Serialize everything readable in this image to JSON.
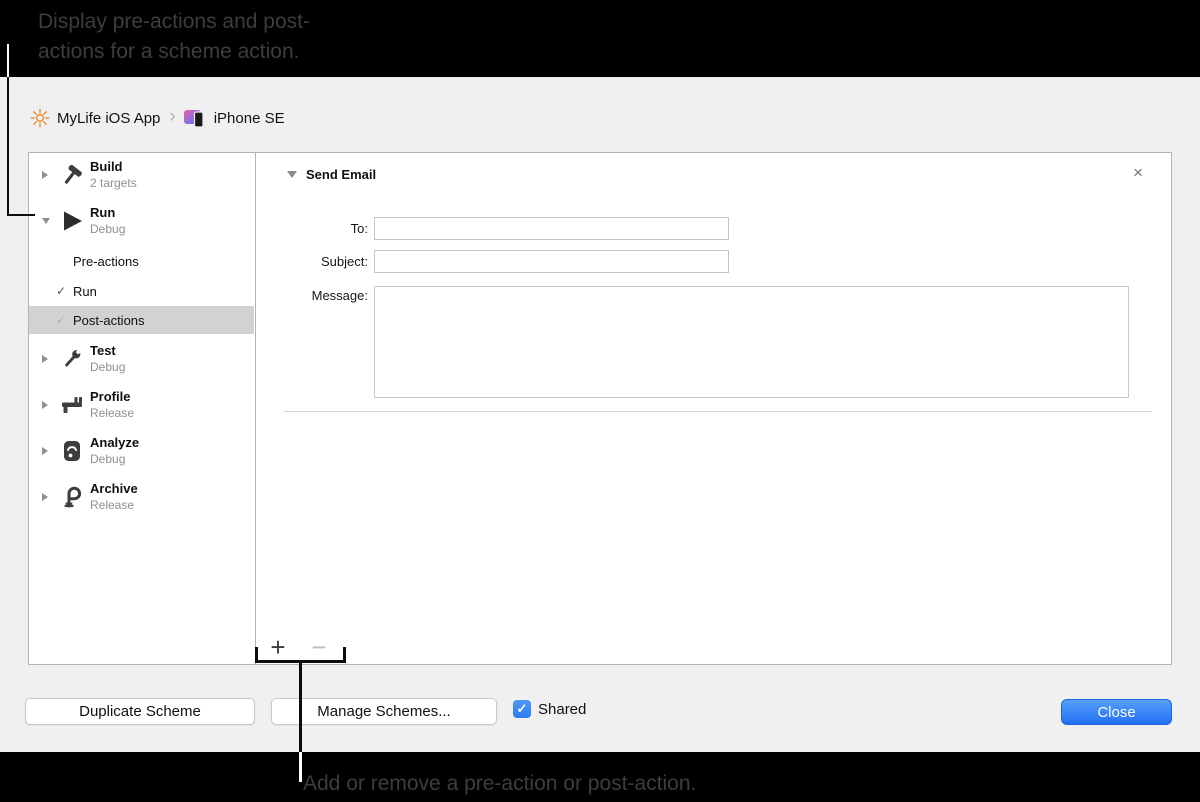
{
  "callouts": {
    "top_line1": "Display pre-actions and post-",
    "top_line2": "actions for a scheme action.",
    "bottom": "Add or remove a pre-action or post-action."
  },
  "glyphs": {
    "check": "✓",
    "close": "×",
    "plus": "+",
    "minus": "−"
  },
  "breadcrumb": {
    "scheme_name": "MyLife iOS App",
    "separator": "›",
    "destination_name": "iPhone SE"
  },
  "sidebar": {
    "build": {
      "label": "Build",
      "sublabel": "2 targets"
    },
    "run": {
      "label": "Run",
      "sublabel": "Debug"
    },
    "run_children": {
      "pre": "Pre-actions",
      "run": "Run",
      "post": "Post-actions"
    },
    "test": {
      "label": "Test",
      "sublabel": "Debug"
    },
    "profile": {
      "label": "Profile",
      "sublabel": "Release"
    },
    "analyze": {
      "label": "Analyze",
      "sublabel": "Debug"
    },
    "archive": {
      "label": "Archive",
      "sublabel": "Release"
    }
  },
  "action_panel": {
    "title": "Send Email",
    "to_label": "To:",
    "subject_label": "Subject:",
    "message_label": "Message:",
    "to_value": "",
    "subject_value": "",
    "message_value": ""
  },
  "footer": {
    "duplicate_label": "Duplicate Scheme",
    "manage_label": "Manage Schemes...",
    "shared_label": "Shared",
    "shared_checked": true,
    "close_label": "Close"
  },
  "colors": {
    "accent_blue": "#2f7cf6",
    "checkbox_blue": "#3b87f7",
    "selection_gray": "#d2d2d2",
    "scheme_icon_orange": "#e8913a",
    "callout_text_gray": "#3d3d3d"
  }
}
